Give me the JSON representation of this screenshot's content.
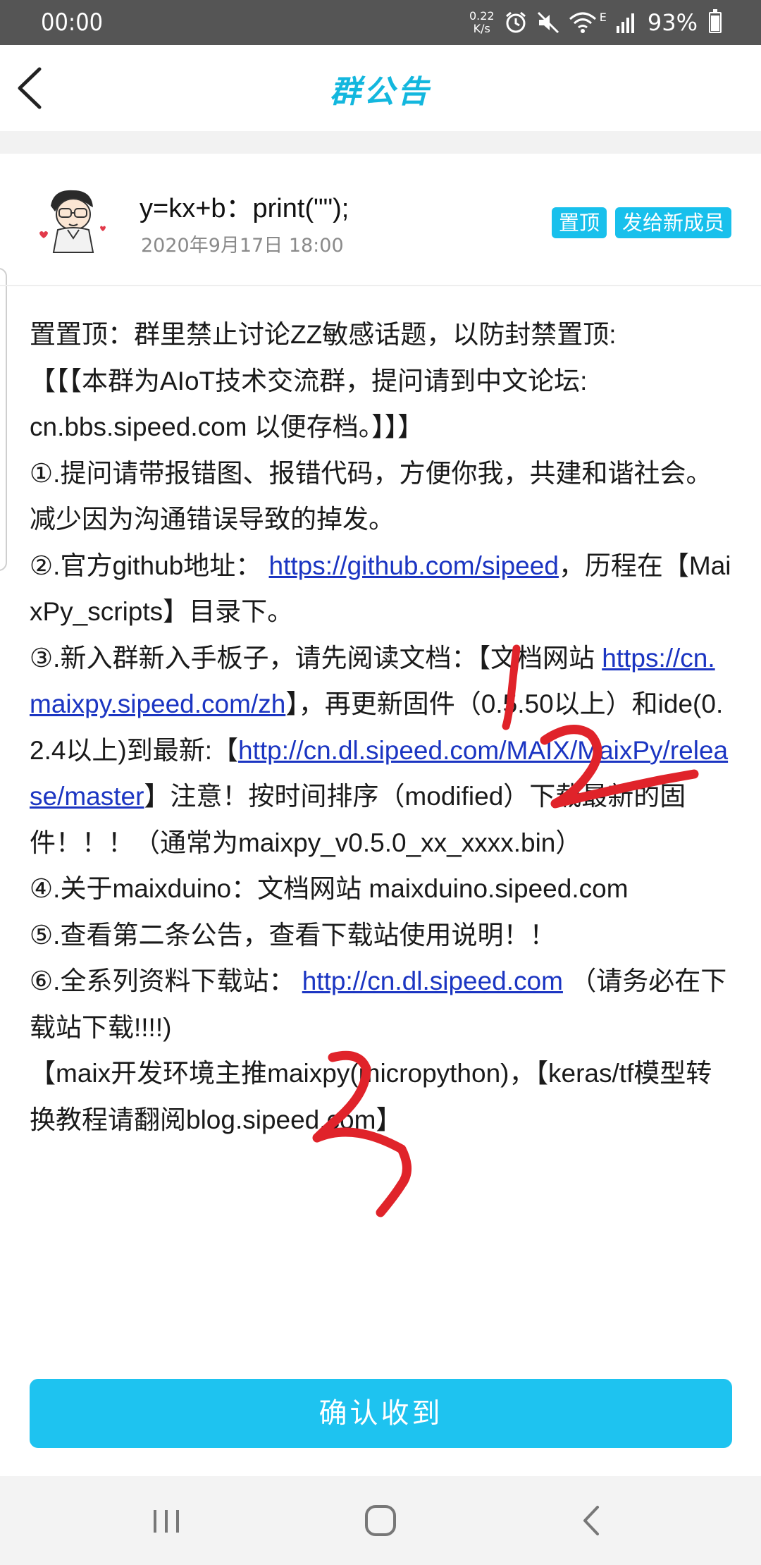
{
  "status_bar": {
    "time": "00:00",
    "net_speed_value": "0.22",
    "net_speed_unit": "K/s",
    "network_type": "E",
    "battery": "93%",
    "icons": [
      "alarm-icon",
      "mute-icon",
      "wifi-icon",
      "signal-icon",
      "battery-icon"
    ]
  },
  "header": {
    "title": "群公告",
    "back_icon": "back-arrow-icon"
  },
  "post": {
    "author": "y=kx+b：print(\"\");",
    "time": "2020年9月17日 18:00",
    "tags": [
      "置顶",
      "发给新成员"
    ]
  },
  "notice": {
    "l1": "置置顶：群里禁止讨论ZZ敏感话题，以防封禁置顶:",
    "l2": "【【【本群为AIoT技术交流群，提问请到中文论坛:",
    "l3": "cn.bbs.sipeed.com 以便存档。】】】",
    "l4": "①.提问请带报错图、报错代码，方便你我，共建和谐社会。减少因为沟通错误导致的掉发。",
    "l5_prefix": "②.官方github地址：",
    "l5_link": "https://github.com/sipeed",
    "l5_suffix": "，历程在【MaixPy_scripts】目录下。",
    "l6_prefix": "③.新入群新入手板子，请先阅读文档：【文档网站 ",
    "l6_link": "https://cn.maixpy.sipeed.com/zh",
    "l6_suffix": "】，再更新固件（0.5.50以上）和ide(0.2.4以上)到最新:【",
    "l7_link": "http://cn.dl.sipeed.com/MAIX/MaixPy/release/master",
    "l7_suffix": "】注意！按时间排序（modified）下载最新的固件！！！（通常为maixpy_v0.5.0_xx_xxxx.bin）",
    "l8": "④.关于maixduino：文档网站 maixduino.sipeed.com",
    "l9": "⑤.查看第二条公告，查看下载站使用说明！！",
    "l10_prefix": "⑥.全系列资料下载站：",
    "l10_link": "http://cn.dl.sipeed.com",
    "l10_suffix": " （请务必在下载站下载!!!!)",
    "l11": "【maix开发环境主推maixpy(micropython)，【keras/tf模型转换教程请翻阅blog.sipeed.com】"
  },
  "confirm_label": "确认收到",
  "colors": {
    "accent": "#1ec3f0",
    "title": "#13b7de",
    "link": "#1b35c2",
    "annotation": "#e0232a"
  },
  "nav": {
    "icons": [
      "recent-apps-icon",
      "home-icon",
      "back-icon"
    ]
  }
}
